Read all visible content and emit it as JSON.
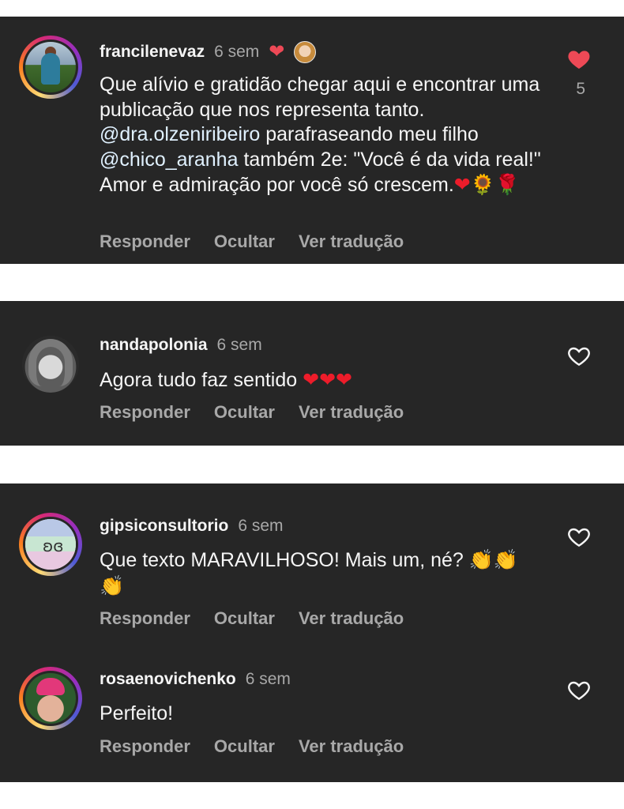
{
  "colors": {
    "card_bg": "#262626",
    "text": "#f5f5f5",
    "muted": "#a8a8a8",
    "like_red": "#ed4956",
    "mention": "#e0f1ff"
  },
  "actions": {
    "reply": "Responder",
    "hide": "Ocultar",
    "translate": "Ver tradução"
  },
  "comments": [
    {
      "username": "francilenevaz",
      "time": "6 sem",
      "author_liked_icon": "heart-icon",
      "text_part1": "Que alívio e gratidão chegar aqui e encontrar uma publicação que nos representa tanto. ",
      "mention1": "@dra.olzeniribeiro",
      "text_part2": " parafraseando meu filho ",
      "mention2": "@chico_aranha",
      "text_part3": " também 2e: \"Você é da vida real!\" Amor e admiração por você só crescem.",
      "emojis": [
        "❤",
        "🌻",
        "🌹"
      ],
      "liked": true,
      "like_count": "5"
    },
    {
      "username": "nandapolonia",
      "time": "6 sem",
      "text": "Agora tudo faz sentido ",
      "emojis": [
        "❤",
        "❤",
        "❤"
      ],
      "liked": false
    },
    {
      "username": "gipsiconsultorio",
      "time": "6 sem",
      "text": "Que texto MARAVILHOSO! Mais um, né? ",
      "emojis": [
        "👏",
        "👏",
        "👏"
      ],
      "liked": false
    },
    {
      "username": "rosaenovichenko",
      "time": "6 sem",
      "text": "Perfeito!",
      "liked": false
    }
  ]
}
